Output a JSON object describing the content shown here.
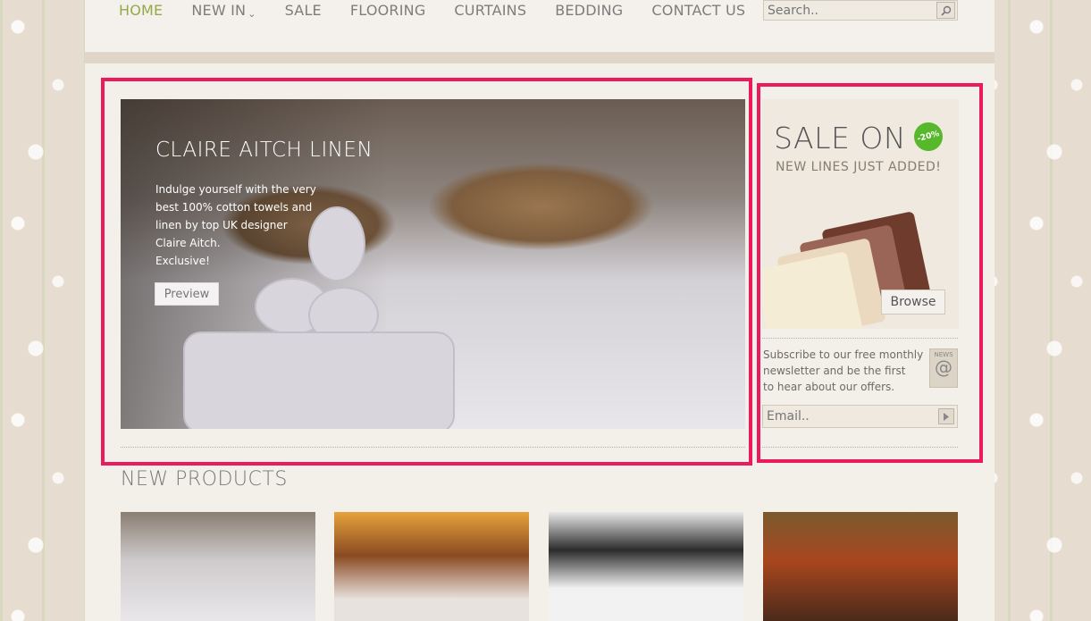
{
  "nav": {
    "items": [
      {
        "label": "HOME",
        "active": true
      },
      {
        "label": "NEW IN",
        "has_dropdown": true
      },
      {
        "label": "SALE"
      },
      {
        "label": "FLOORING"
      },
      {
        "label": "CURTAINS"
      },
      {
        "label": "BEDDING"
      },
      {
        "label": "CONTACT US"
      }
    ],
    "caret": "⌄"
  },
  "search": {
    "placeholder": "Search..",
    "icon": "search-icon"
  },
  "hero": {
    "title": "CLAIRE AITCH LINEN",
    "text_lines": [
      "Indulge yourself with the very",
      "best 100% cotton towels and",
      "linen by top UK designer",
      "Claire Aitch.",
      "Exclusive!"
    ],
    "button": "Preview"
  },
  "sale": {
    "title": "SALE ON",
    "badge": "-20%",
    "subtitle": "NEW LINES JUST ADDED!",
    "button": "Browse"
  },
  "newsletter": {
    "text_lines": [
      "Subscribe to our free monthly",
      "newsletter and be the first",
      "to hear about our offers."
    ],
    "icon_label": "NEWS",
    "icon_symbol": "@",
    "email_placeholder": "Email.."
  },
  "new_products": {
    "title": "NEW PRODUCTS"
  },
  "colors": {
    "accent": "#95a948",
    "highlight": "#ea1a5b"
  }
}
